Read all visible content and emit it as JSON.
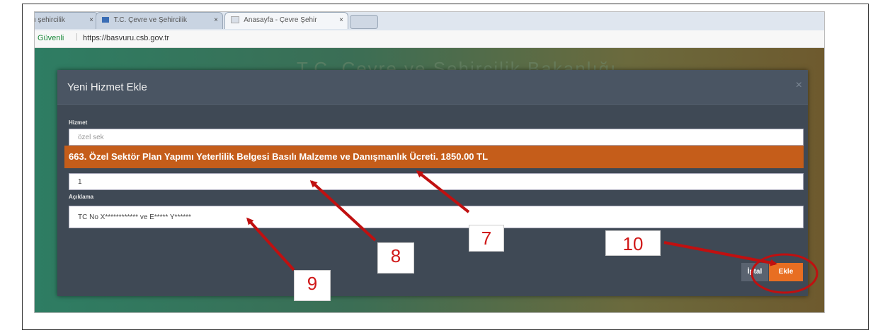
{
  "browser": {
    "tabs": [
      {
        "label": "ı şehircilik",
        "close": "×"
      },
      {
        "label": "T.C. Çevre ve Şehircilik",
        "close": "×"
      },
      {
        "label": "Anasayfa - Çevre Şehir",
        "close": "×"
      }
    ],
    "secure_label": "Güvenli",
    "separator": "|",
    "url": "https://basvuru.csb.gov.tr"
  },
  "page": {
    "background_title": "T.C. Çevre ve Şehircilik Bakanlığı"
  },
  "modal": {
    "title": "Yeni Hizmet Ekle",
    "close": "×",
    "hizmet_label": "Hizmet",
    "hizmet_value": "özel sek",
    "selected_option": "663.  Özel Sektör Plan Yapımı Yeterlilik Belgesi Basılı Malzeme ve Danışmanlık Ücreti. 1850.00 TL",
    "quantity_value": "1",
    "aciklama_label": "Açıklama",
    "aciklama_value": "TC No X************ ve E***** Y******",
    "cancel_label": "İptal",
    "add_label": "Ekle"
  },
  "annotations": {
    "n7": "7",
    "n8": "8",
    "n9": "9",
    "n10": "10",
    "arrow_color": "#c01010"
  }
}
